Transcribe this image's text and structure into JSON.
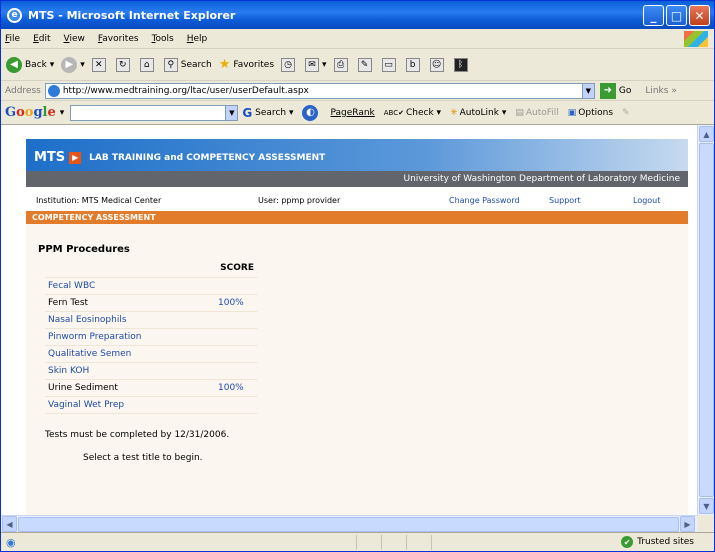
{
  "window": {
    "title": "MTS - Microsoft Internet Explorer"
  },
  "menu": [
    "File",
    "Edit",
    "View",
    "Favorites",
    "Tools",
    "Help"
  ],
  "toolbar": {
    "back": "Back",
    "search": "Search",
    "favorites": "Favorites"
  },
  "address": {
    "label": "Address",
    "url": "http://www.medtraining.org/ltac/user/userDefault.aspx",
    "go": "Go",
    "links": "Links"
  },
  "google": {
    "search": "Search",
    "pagerank": "PageRank",
    "check": "Check",
    "autolink": "AutoLink",
    "autofill": "AutoFill",
    "options": "Options"
  },
  "page": {
    "logo": "MTS",
    "tagline": "LAB TRAINING and COMPETENCY ASSESSMENT",
    "department": "University of Washington Department of Laboratory Medicine",
    "institution": "Institution:  MTS Medical Center",
    "user": "User:  ppmp provider",
    "change_password": "Change Password",
    "support": "Support",
    "logout": "Logout",
    "section": "COMPETENCY ASSESSMENT",
    "procedures_title": "PPM Procedures",
    "score_header": "SCORE",
    "procedures": [
      {
        "name": "Fecal WBC",
        "score": "",
        "link": true
      },
      {
        "name": "Fern Test",
        "score": "100%",
        "link": false
      },
      {
        "name": "Nasal Eosinophils",
        "score": "",
        "link": true
      },
      {
        "name": "Pinworm Preparation",
        "score": "",
        "link": true
      },
      {
        "name": "Qualitative Semen",
        "score": "",
        "link": true
      },
      {
        "name": "Skin KOH",
        "score": "",
        "link": true
      },
      {
        "name": "Urine Sediment",
        "score": "100%",
        "link": false
      },
      {
        "name": "Vaginal Wet Prep",
        "score": "",
        "link": true
      }
    ],
    "deadline_note": "Tests must be completed by 12/31/2006.",
    "select_note": "Select a test title to begin."
  },
  "status": {
    "zone": "Trusted sites"
  }
}
